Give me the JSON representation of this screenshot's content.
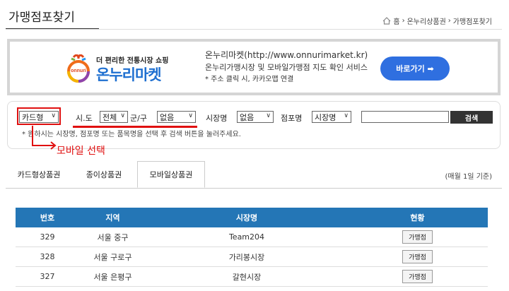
{
  "header": {
    "title": "가맹점포찾기",
    "breadcrumb": [
      "홈",
      "온누리상품권",
      "가맹점포찾기"
    ]
  },
  "banner": {
    "logo_tagline": "더 편리한 전통시장 쇼핑",
    "logo_name": "온누리마켓",
    "logo_badge": "onnuri",
    "desc_line1": "온누리마켓(http://www.onnurimarket.kr)",
    "desc_line2": "온누리가맹시장 및 모바일가맹점 지도 확인 서비스",
    "desc_line3": "* 주소 클릭 시, 카카오맵 연결",
    "go_button": "바로가기 ➡"
  },
  "search": {
    "card_type": "카드형",
    "sido_label": "시.도",
    "sido_value": "전체",
    "gungu_label": "군/구",
    "gungu_value": "없음",
    "market_label": "시장명",
    "market_value": "없음",
    "store_label": "점포명",
    "store_value": "시장명",
    "search_button": "검색",
    "hint": "* 원하시는 시장명, 점포명 또는 품목명을 선택 후 검색 버튼을 눌러주세요."
  },
  "annotation": {
    "text": "모바일 선택",
    "color": "#e01010"
  },
  "tabs": {
    "items": [
      "카드형상품권",
      "종이상품권",
      "모바일상품권"
    ],
    "active": "모바일상품권",
    "note": "(매월 1일 기준)"
  },
  "table": {
    "headers": [
      "번호",
      "지역",
      "시장명",
      "현황"
    ],
    "rows": [
      {
        "no": "329",
        "region": "서울 중구",
        "market": "Team204",
        "status": "가맹점"
      },
      {
        "no": "328",
        "region": "서울 구로구",
        "market": "가리봉시장",
        "status": "가맹점"
      },
      {
        "no": "327",
        "region": "서울 은평구",
        "market": "갈현시장",
        "status": "가맹점"
      }
    ]
  },
  "colors": {
    "table_header": "#2476b6",
    "go_button": "#2f6fe0",
    "logo_text": "#1e6fd0"
  }
}
